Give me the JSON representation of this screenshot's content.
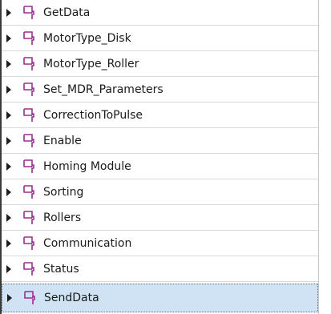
{
  "tree": {
    "items": [
      {
        "label": "GetData",
        "icon": "program-block-icon",
        "expanded": false
      },
      {
        "label": "MotorType_Disk",
        "icon": "program-block-icon",
        "expanded": false
      },
      {
        "label": "MotorType_Roller",
        "icon": "program-block-icon",
        "expanded": false
      },
      {
        "label": "Set_MDR_Parameters",
        "icon": "program-block-icon",
        "expanded": false
      },
      {
        "label": "CorrectionToPulse",
        "icon": "program-block-icon",
        "expanded": false
      },
      {
        "label": "Enable",
        "icon": "program-block-icon",
        "expanded": false
      },
      {
        "label": "Homing Module",
        "icon": "program-block-icon",
        "expanded": false
      },
      {
        "label": "Sorting",
        "icon": "program-block-icon",
        "expanded": false
      },
      {
        "label": "Rollers",
        "icon": "program-block-icon",
        "expanded": false
      },
      {
        "label": "Communication",
        "icon": "program-block-icon",
        "expanded": false
      },
      {
        "label": "Status",
        "icon": "program-block-icon",
        "expanded": false
      },
      {
        "label": "SendData",
        "icon": "program-block-icon",
        "expanded": false,
        "selected": true
      }
    ]
  },
  "colors": {
    "icon": "#9b2f8f",
    "selected_bg": "#cfe3f5",
    "row_divider": "#d9d9d9"
  }
}
